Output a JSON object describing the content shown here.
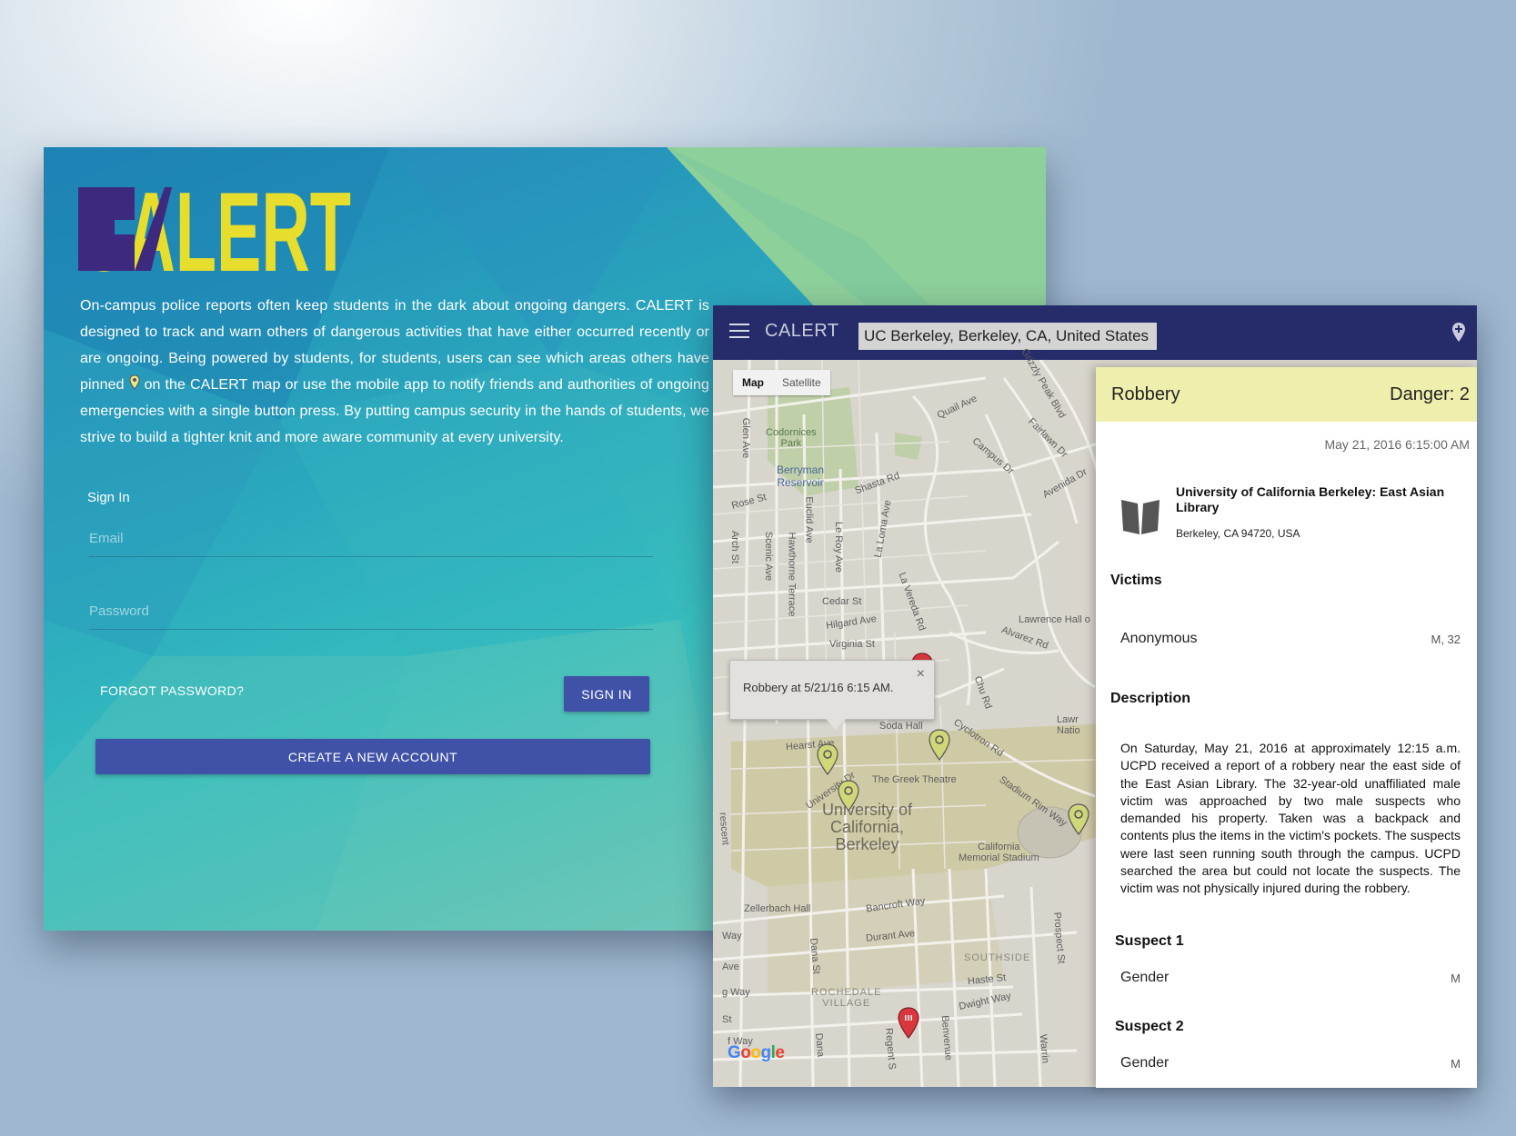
{
  "colors": {
    "accent": "#3f52a8",
    "toolbar": "#262c6a",
    "danger_header": "#efefad",
    "logo_purple": "#3d2a7e",
    "logo_yellow": "#e6dd2c"
  },
  "login": {
    "logo_text": "CALERT",
    "intro_before_pin": "On-campus police reports often keep students in the dark about ongoing dangers. CALERT is designed to track and warn others of dangerous activities that have either occurred recently or are ongoing. Being powered by students, for students, users can see which areas others have pinned ",
    "intro_after_pin": " on the CALERT map or use the mobile app to notify friends and authorities of ongoing emergencies with a single button press. By putting campus security in the hands of students, we strive to build a tighter knit and more aware community at every university.",
    "pin_icon": "map-pin-icon",
    "sign_in_title": "Sign In",
    "email_placeholder": "Email",
    "password_placeholder": "Password",
    "forgot_label": "FORGOT PASSWORD?",
    "sign_in_label": "SIGN IN",
    "create_label": "CREATE A NEW ACCOUNT"
  },
  "app": {
    "title": "CALERT",
    "menu_icon": "hamburger-menu-icon",
    "search_value": "UC Berkeley, Berkeley, CA, United States",
    "location_icon": "add-location-icon"
  },
  "map": {
    "type_map": "Map",
    "type_satellite": "Satellite",
    "infowindow_text": "Robbery at 5/21/16 6:15 AM.",
    "infowindow_close": "×",
    "google_letters": [
      "G",
      "o",
      "o",
      "g",
      "l",
      "e"
    ],
    "labels": {
      "codornices": "Codornices\nPark",
      "berryman": "Berryman\nReservoir",
      "shasta": "Shasta Rd",
      "quail": "Quail Ave",
      "grizzly": "Grizzly Peak Blvd",
      "fairlawn": "Fairlawn Dr",
      "campus_dr": "Campus Dr",
      "avenida": "Avenida Dr",
      "glen": "Glen Ave",
      "rose": "Rose St",
      "arch": "Arch St",
      "scenic": "Scenic Ave",
      "hawthorne": "Hawthorne Terrace",
      "euclid": "Euclid Ave",
      "leroy": "Le Roy Ave",
      "laloma": "La Loma Ave",
      "lavereda": "La Vereda Rd",
      "cedar": "Cedar St",
      "hilgard": "Hilgard Ave",
      "virginia": "Virginia St",
      "lawrence": "Lawrence Hall o",
      "alvarez": "Alvarez Rd",
      "chu": "Chu Rd",
      "soda": "Soda Hall",
      "hearst": "Hearst Ave",
      "greek": "The Greek Theatre",
      "cyclotron": "Cyclotron Rd",
      "university_dr": "University Dr",
      "ucb": "University of\nCalifornia,\nBerkeley",
      "stadium": "Stadium Rim Way",
      "memorial": "California\nMemorial Stadium",
      "zellerbach": "Zellerbach Hall",
      "bancroft": "Bancroft Way",
      "durant": "Durant Ave",
      "dana": "Dana St",
      "southside": "SOUTHSIDE",
      "haste": "Haste St",
      "prospect": "Prospect St",
      "rochedale": "ROCHEDALE\nVILLAGE",
      "dwight": "Dwight Way",
      "benvenue": "Benvenue",
      "regent": "Regent S",
      "warring": "Warrin",
      "lawr_nat": "Lawr\nNatio",
      "way1": "Way",
      "ave1": "Ave",
      "gway": "g Way",
      "st1": "St",
      "fway": "f Way",
      "dana2": "Dana",
      "crescent": "rescent"
    }
  },
  "detail": {
    "crime_type": "Robbery",
    "danger_label": "Danger: 2",
    "datetime": "May 21, 2016 6:15:00 AM",
    "place_icon": "book-icon",
    "place_name": "University of California Berkeley: East Asian Library",
    "place_address": "Berkeley, CA 94720, USA",
    "victims_title": "Victims",
    "victim_name": "Anonymous",
    "victim_info": "M, 32",
    "description_title": "Description",
    "description": "On Saturday, May 21, 2016 at approximately 12:15 a.m. UCPD received a report of a robbery near the east side of the East Asian Library. The 32-year-old unaffiliated male victim was approached by two male suspects who demanded his property. Taken was a backpack and contents plus the items in the victim's pockets. The suspects were last seen running south through the campus. UCPD searched the area but could not locate the suspects. The victim was not physically injured during the robbery.",
    "suspect1_title": "Suspect 1",
    "suspect1_gender_label": "Gender",
    "suspect1_gender": "M",
    "suspect2_title": "Suspect 2",
    "suspect2_gender_label": "Gender",
    "suspect2_gender": "M"
  }
}
